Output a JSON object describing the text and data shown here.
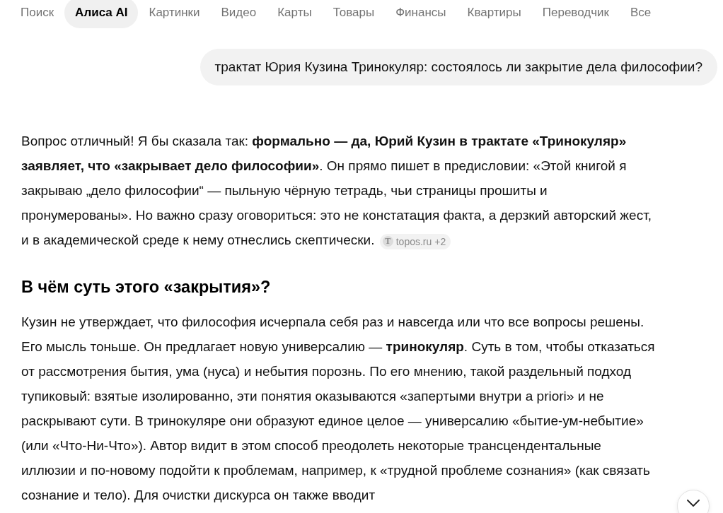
{
  "tabs": [
    {
      "label": "Поиск",
      "selected": false
    },
    {
      "label": "Алиса AI",
      "selected": true
    },
    {
      "label": "Картинки",
      "selected": false
    },
    {
      "label": "Видео",
      "selected": false
    },
    {
      "label": "Карты",
      "selected": false
    },
    {
      "label": "Товары",
      "selected": false
    },
    {
      "label": "Финансы",
      "selected": false
    },
    {
      "label": "Квартиры",
      "selected": false
    },
    {
      "label": "Переводчик",
      "selected": false
    },
    {
      "label": "Все",
      "selected": false
    }
  ],
  "user_message": {
    "text": "трактат Юрия Кузина Тринокуляр: состоялось ли закрытие дела философии?"
  },
  "answer": {
    "intro": "Вопрос отличный! Я бы сказала так: **формально — да, Юрий Кузин в трактате «Тринокуляр» заявляет, что «закрывает дело философии»**. Он прямо пишет в предисловии: «Этой книгой я закрываю „дело философии“ — пыльную чёрную тетрадь, чьи страницы прошиты и пронумерованы». Но важно сразу оговориться: это не констатация факта, а дерзкий авторский жест, и в академической среде к нему отнеслись скептически.",
    "source_chip": {
      "favicon_letter": "T",
      "site": "topos.ru",
      "more": "+2"
    },
    "heading": "В чём суть этого «закрытия»?",
    "paragraph": "Кузин не утверждает, что философия исчерпала себя раз и навсегда или что все вопросы решены. Его мысль тоньше. Он предлагает новую универсалию — **тринокуляр**. Суть в том, чтобы отказаться от рассмотрения бытия, ума (нуса) и небытия порознь. По его мнению, такой раздельный подход тупиковый: взятые изолированно, эти понятия оказываются «запертыми внутри a priori» и не раскрывают сути. В тринокуляре они образуют единое целое — универсалию «бытие-ум-небытие» (или «Что-Ни-Что»). Автор видит в этом способ преодолеть некоторые трансцендентальные иллюзии и по-новому подойти к проблемам, например, к «трудной проблеме сознания» (как связать сознание и тело). Для очистки дискурса он также вводит"
  }
}
